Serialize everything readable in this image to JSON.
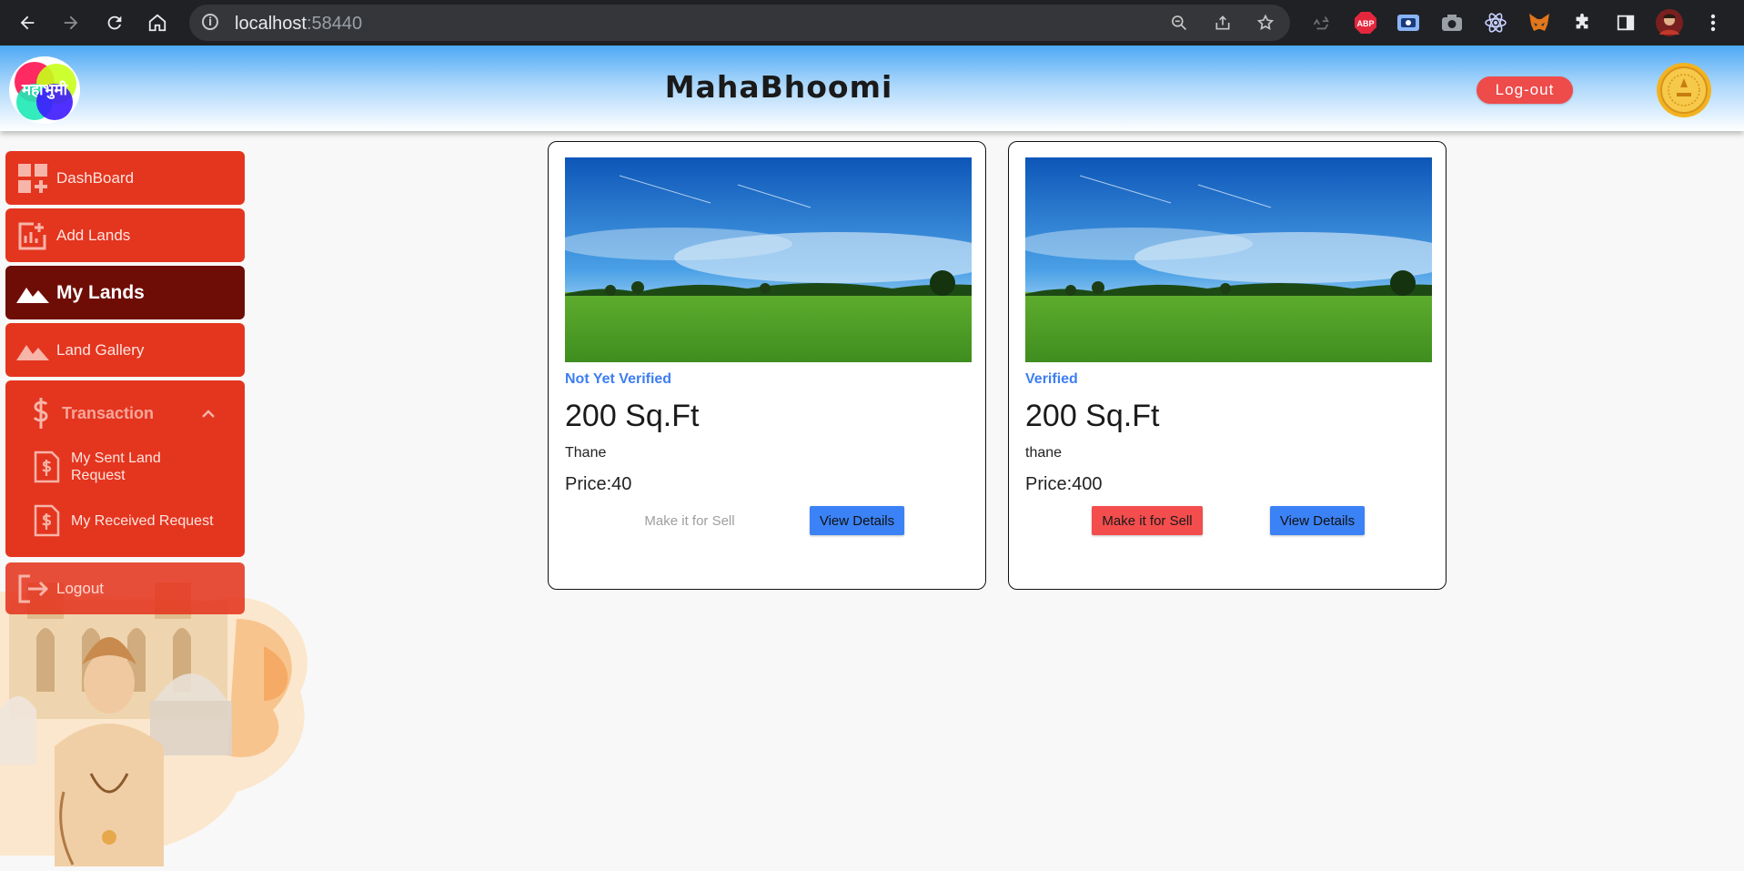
{
  "browser": {
    "url_host": "localhost",
    "url_port": ":58440",
    "icons": [
      "back-icon",
      "forward-icon",
      "reload-icon",
      "home-icon",
      "info-icon",
      "zoom-icon",
      "share-icon",
      "star-icon",
      "recycle-icon",
      "abp-icon",
      "screen-icon",
      "camera-icon",
      "react-icon",
      "metamask-icon",
      "puzzle-icon",
      "sidepanel-icon",
      "profile-avatar",
      "menu-icon"
    ],
    "abp_label": "ABP"
  },
  "header": {
    "logo_text": "महाभुमी",
    "title": "MahaBhoomi",
    "logout_label": "Log-out"
  },
  "sidebar": {
    "items": [
      {
        "label": "DashBoard",
        "icon": "dashboard-icon"
      },
      {
        "label": "Add Lands",
        "icon": "add-chart-icon"
      },
      {
        "label": "My Lands",
        "icon": "landscape-icon"
      },
      {
        "label": "Land Gallery",
        "icon": "landscape-icon"
      }
    ],
    "transaction": {
      "label": "Transaction",
      "icon": "dollar-icon",
      "expanded": true,
      "sub_items": [
        {
          "label": "My Sent Land Request",
          "icon": "receipt-dollar-icon"
        },
        {
          "label": "My Received Request",
          "icon": "receipt-dollar-icon"
        }
      ]
    },
    "logout": {
      "label": "Logout",
      "icon": "logout-icon"
    }
  },
  "cards": [
    {
      "status": "Not Yet Verified",
      "area": "200 Sq.Ft",
      "city": "Thane",
      "price": "Price:40",
      "sell_label": "Make it for Sell",
      "sell_enabled": false,
      "view_label": "View Details"
    },
    {
      "status": "Verified",
      "area": "200 Sq.Ft",
      "city": "thane",
      "price": "Price:400",
      "sell_label": "Make it for Sell",
      "sell_enabled": true,
      "view_label": "View Details"
    }
  ],
  "colors": {
    "sidebar": "#e4351f",
    "sidebar_active": "#6e0d06",
    "status_text": "#3d7ef2",
    "view_button": "#3b82f6",
    "sell_button": "#f34d4d",
    "logout_pill": "#ee4b4b"
  }
}
